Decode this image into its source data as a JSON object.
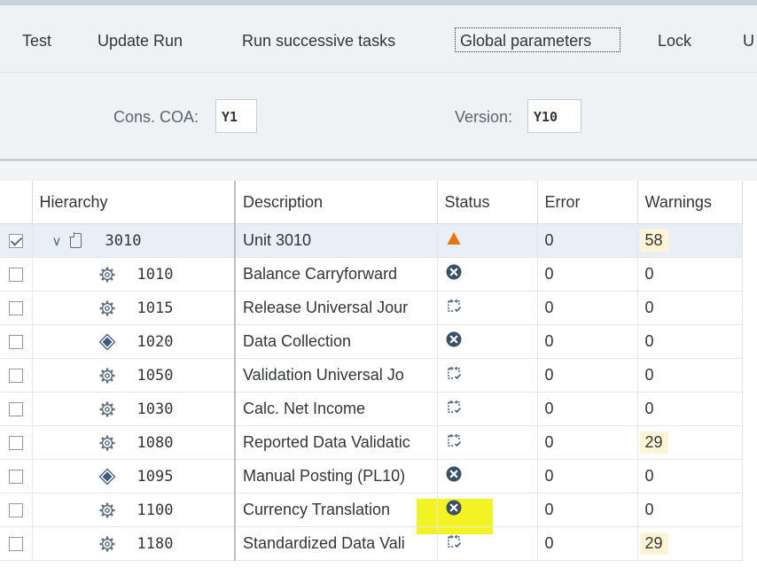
{
  "toolbar": {
    "buttons": [
      "Test",
      "Update Run",
      "Run successive tasks",
      "Global parameters",
      "Lock",
      "U"
    ]
  },
  "filters": {
    "coa_label": "Cons. COA:",
    "coa_value": "Y1",
    "version_label": "Version:",
    "version_value": "Y10"
  },
  "columns": {
    "hierarchy": "Hierarchy",
    "description": "Description",
    "status": "Status",
    "error": "Error",
    "warnings": "Warnings"
  },
  "colors": {
    "warn_orange": "#e9730c",
    "status_blue": "#3d5a80",
    "highlight": "#f3f323",
    "warning_bg": "#fff5d4"
  },
  "rows": [
    {
      "id": "3010",
      "desc": "Unit 3010",
      "status": "warning-triangle-icon",
      "error": "0",
      "warnings": "58",
      "type": "unit",
      "checked": true,
      "warn_hl": true
    },
    {
      "id": "1010",
      "desc": "Balance Carryforward",
      "status": "error-circle-icon",
      "error": "0",
      "warnings": "0",
      "type": "gear",
      "checked": false,
      "warn_hl": false
    },
    {
      "id": "1015",
      "desc": "Release Universal Jour",
      "status": "calendar-check-icon",
      "error": "0",
      "warnings": "0",
      "type": "gear",
      "checked": false,
      "warn_hl": false
    },
    {
      "id": "1020",
      "desc": "Data Collection",
      "status": "error-circle-icon",
      "error": "0",
      "warnings": "0",
      "type": "diamond",
      "checked": false,
      "warn_hl": false
    },
    {
      "id": "1050",
      "desc": "Validation Universal Jo",
      "status": "calendar-check-icon",
      "error": "0",
      "warnings": "0",
      "type": "gear",
      "checked": false,
      "warn_hl": false
    },
    {
      "id": "1030",
      "desc": "Calc. Net Income",
      "status": "calendar-check-icon",
      "error": "0",
      "warnings": "0",
      "type": "gear",
      "checked": false,
      "warn_hl": false
    },
    {
      "id": "1080",
      "desc": "Reported Data Validatic",
      "status": "calendar-check-icon",
      "error": "0",
      "warnings": "29",
      "type": "gear",
      "checked": false,
      "warn_hl": true
    },
    {
      "id": "1095",
      "desc": "Manual Posting (PL10)",
      "status": "error-circle-icon",
      "error": "0",
      "warnings": "0",
      "type": "diamond",
      "checked": false,
      "warn_hl": false
    },
    {
      "id": "1100",
      "desc": "Currency Translation",
      "status": "error-circle-icon",
      "error": "0",
      "warnings": "0",
      "type": "gear",
      "checked": false,
      "warn_hl": false
    },
    {
      "id": "1180",
      "desc": "Standardized Data Vali",
      "status": "calendar-check-icon",
      "error": "0",
      "warnings": "29",
      "type": "gear",
      "checked": false,
      "warn_hl": true
    }
  ]
}
